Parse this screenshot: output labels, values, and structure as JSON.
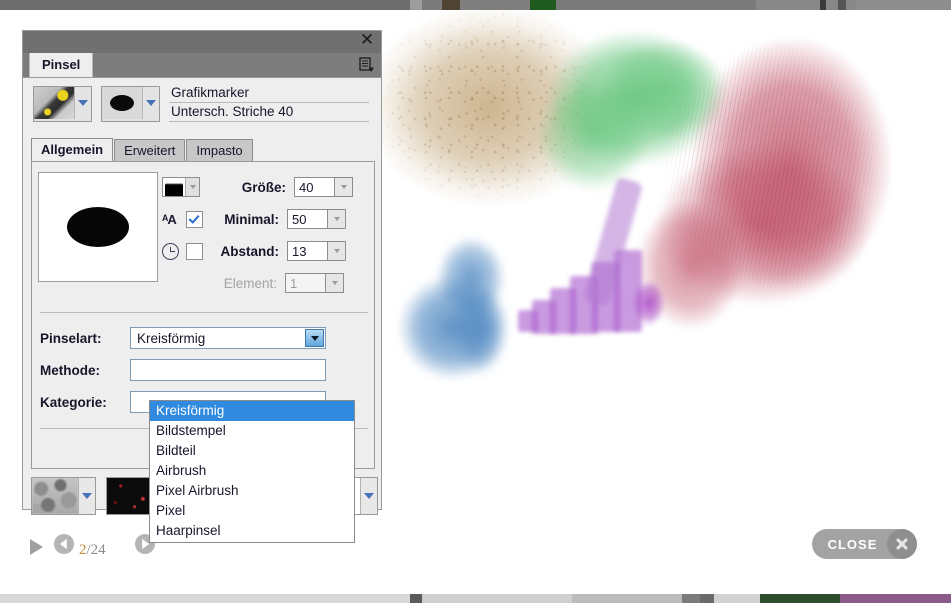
{
  "dialog": {
    "title_bar": {
      "close_icon": "close-icon"
    },
    "panel_tab": "Pinsel",
    "panel_menu_icon": "panel-menu-icon",
    "brush_header": {
      "variant_thumb_icon": "brush-variant-thumbnail",
      "shape_thumb_icon": "brush-shape-thumbnail",
      "name_line1": "Grafikmarker",
      "name_line2": "Untersch. Striche 40"
    },
    "tabs": [
      {
        "label": "Allgemein",
        "active": true
      },
      {
        "label": "Erweitert",
        "active": false
      },
      {
        "label": "Impasto",
        "active": false
      }
    ],
    "options": [
      {
        "icon": "gradient-swatch-icon",
        "label": "Größe:",
        "value": "40",
        "checkbox": null,
        "disabled": false
      },
      {
        "icon": "antialias-icon",
        "label": "Minimal:",
        "value": "50",
        "checkbox": true,
        "disabled": false
      },
      {
        "icon": "clock-icon",
        "label": "Abstand:",
        "value": "13",
        "checkbox": false,
        "disabled": false
      },
      {
        "icon": null,
        "label": "Element:",
        "value": "1",
        "checkbox": null,
        "disabled": true
      }
    ],
    "selects": [
      {
        "label": "Pinselart:",
        "value": "Kreisförmig"
      },
      {
        "label": "Methode:",
        "value": ""
      },
      {
        "label": "Kategorie:",
        "value": ""
      }
    ],
    "dropdown": {
      "open": true,
      "selected": "Kreisförmig",
      "items": [
        "Kreisförmig",
        "Bildstempel",
        "Bildteil",
        "Airbrush",
        "Pixel Airbrush",
        "Pixel",
        "Haarpinsel"
      ]
    },
    "texture_combos": [
      {
        "icon": "paper-texture-thumbnail"
      },
      {
        "icon": "grain-texture-thumbnail"
      },
      {
        "icon": "blank-texture-thumbnail"
      }
    ]
  },
  "bottom_bar": {
    "play_icon": "play-icon",
    "prev_icon": "previous-arrow-icon",
    "next_icon": "next-arrow-icon",
    "current_page": "2",
    "page_separator": "/",
    "total_pages": "24",
    "close_label": "CLOSE",
    "close_icon": "close-x-icon"
  },
  "colors": {
    "panel_bg": "#eeeeee",
    "titlebar": "#707070",
    "tabrow": "#7d7d7d",
    "highlight": "#2f8ae0",
    "select_border": "#7f9db9",
    "accent_page": "#c38a3a",
    "close_button": "#a3a3a3"
  }
}
